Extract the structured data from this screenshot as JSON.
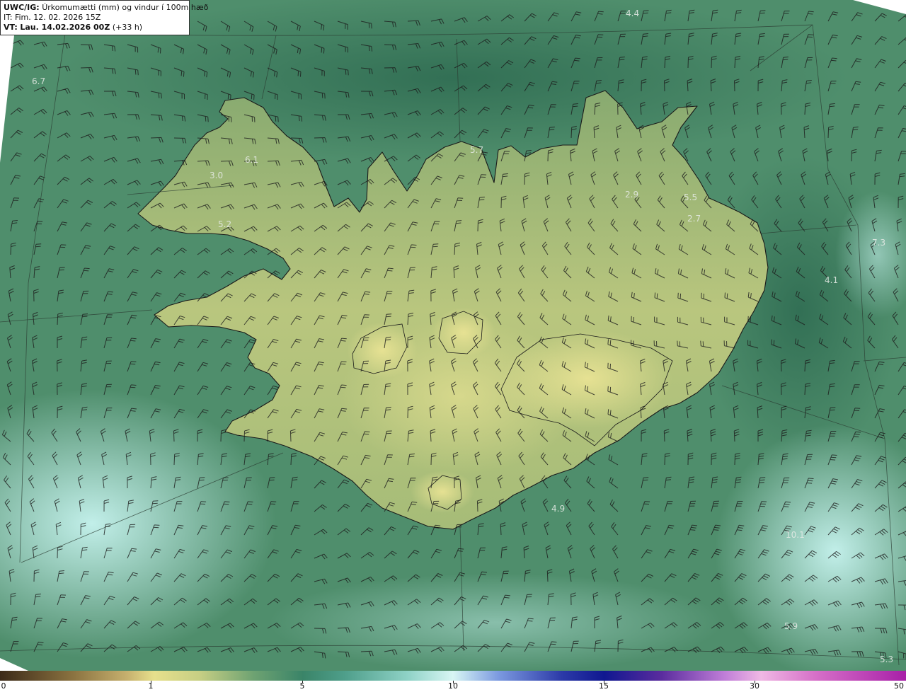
{
  "info": {
    "model": "UWC/IG:",
    "description": "Úrkomumætti (mm) og vindur í 100m hæð",
    "it_line": "IT: Fim. 12. 02. 2026 15Z",
    "vt_prefix": "VT:",
    "vt_value": "Lau. 14.02.2026 00Z",
    "vt_lead": "(+33 h)"
  },
  "colorbar": {
    "labels": [
      "0",
      "1",
      "5",
      "10",
      "15",
      "30",
      "50"
    ]
  },
  "map_labels": [
    {
      "text": "4.4"
    },
    {
      "text": "6.7"
    },
    {
      "text": "6.1"
    },
    {
      "text": "3.0"
    },
    {
      "text": "5.2"
    },
    {
      "text": "5.7"
    },
    {
      "text": "2.9"
    },
    {
      "text": "5.5"
    },
    {
      "text": "2.7"
    },
    {
      "text": "7.3"
    },
    {
      "text": "4.1"
    },
    {
      "text": "4.9"
    },
    {
      "text": "10.1"
    },
    {
      "text": "5.9"
    },
    {
      "text": "5.3"
    }
  ],
  "colors": {
    "sea_low": "#3c7a5e",
    "sea_high": "#b6ece6",
    "land_low": "#8cae78",
    "land_high": "#e4e08e",
    "coast": "#1a1a1a"
  }
}
